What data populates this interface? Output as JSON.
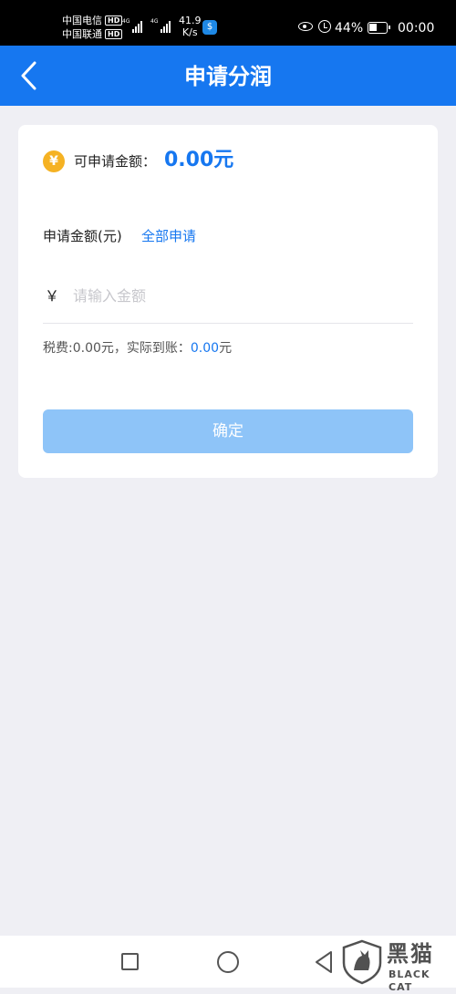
{
  "status_bar": {
    "carrier_1": "中国电信",
    "carrier_2": "中国联通",
    "hd": "HD",
    "lte": "4G",
    "net_speed_value": "41.9",
    "net_speed_unit": "K/s",
    "battery_percent": "44%",
    "time": "00:00",
    "icons": [
      "app-notification-icon",
      "eye-icon",
      "alarm-icon",
      "battery-icon"
    ]
  },
  "nav": {
    "title": "申请分润",
    "back_icon": "chevron-left-icon"
  },
  "card": {
    "available_label": "可申请金额：",
    "available_amount": "0.00元",
    "amount_label": "申请金额(元)",
    "apply_all": "全部申请",
    "currency_symbol": "￥",
    "input_placeholder": "请输入金额",
    "input_value": "",
    "tax_prefix": "税费:0.00元，实际到账：",
    "actual_amount": "0.00",
    "actual_unit": "元",
    "confirm_label": "确定"
  },
  "colors": {
    "primary": "#1677f0",
    "button_disabled": "#8ec4f8",
    "coin": "#f5b223",
    "background": "#efeff4"
  },
  "system_nav": {
    "icons": [
      "recent-apps-icon",
      "home-icon",
      "back-triangle-icon"
    ]
  },
  "watermark": {
    "title": "黑猫",
    "subtitle": "BLACK CAT"
  }
}
